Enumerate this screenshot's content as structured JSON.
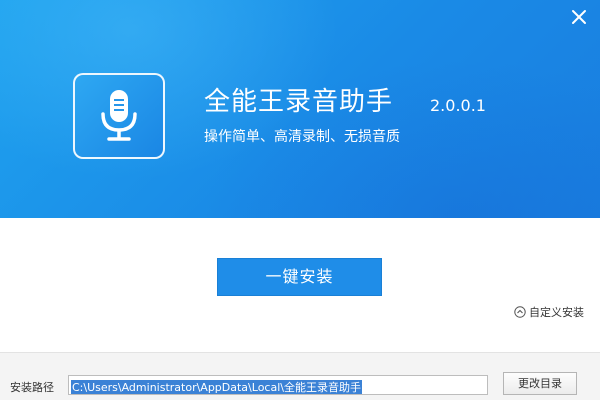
{
  "window": {
    "close_icon": "close-icon"
  },
  "header": {
    "app_icon": "microphone-icon",
    "title": "全能王录音助手",
    "version": "2.0.0.1",
    "tagline": "操作简单、高清录制、无损音质",
    "colors": {
      "gradient_start": "#1fa3ef",
      "gradient_end": "#197ddf"
    }
  },
  "main": {
    "install_label": "一键安装",
    "install_color": "#1f8de8",
    "custom_install_label": "自定义安装",
    "custom_install_icon": "chevron-up-circle-icon"
  },
  "footer": {
    "path_label": "安装路径",
    "path_value": "C:\\Users\\Administrator\\AppData\\Local\\全能王录音助手",
    "browse_label": "更改目录"
  }
}
